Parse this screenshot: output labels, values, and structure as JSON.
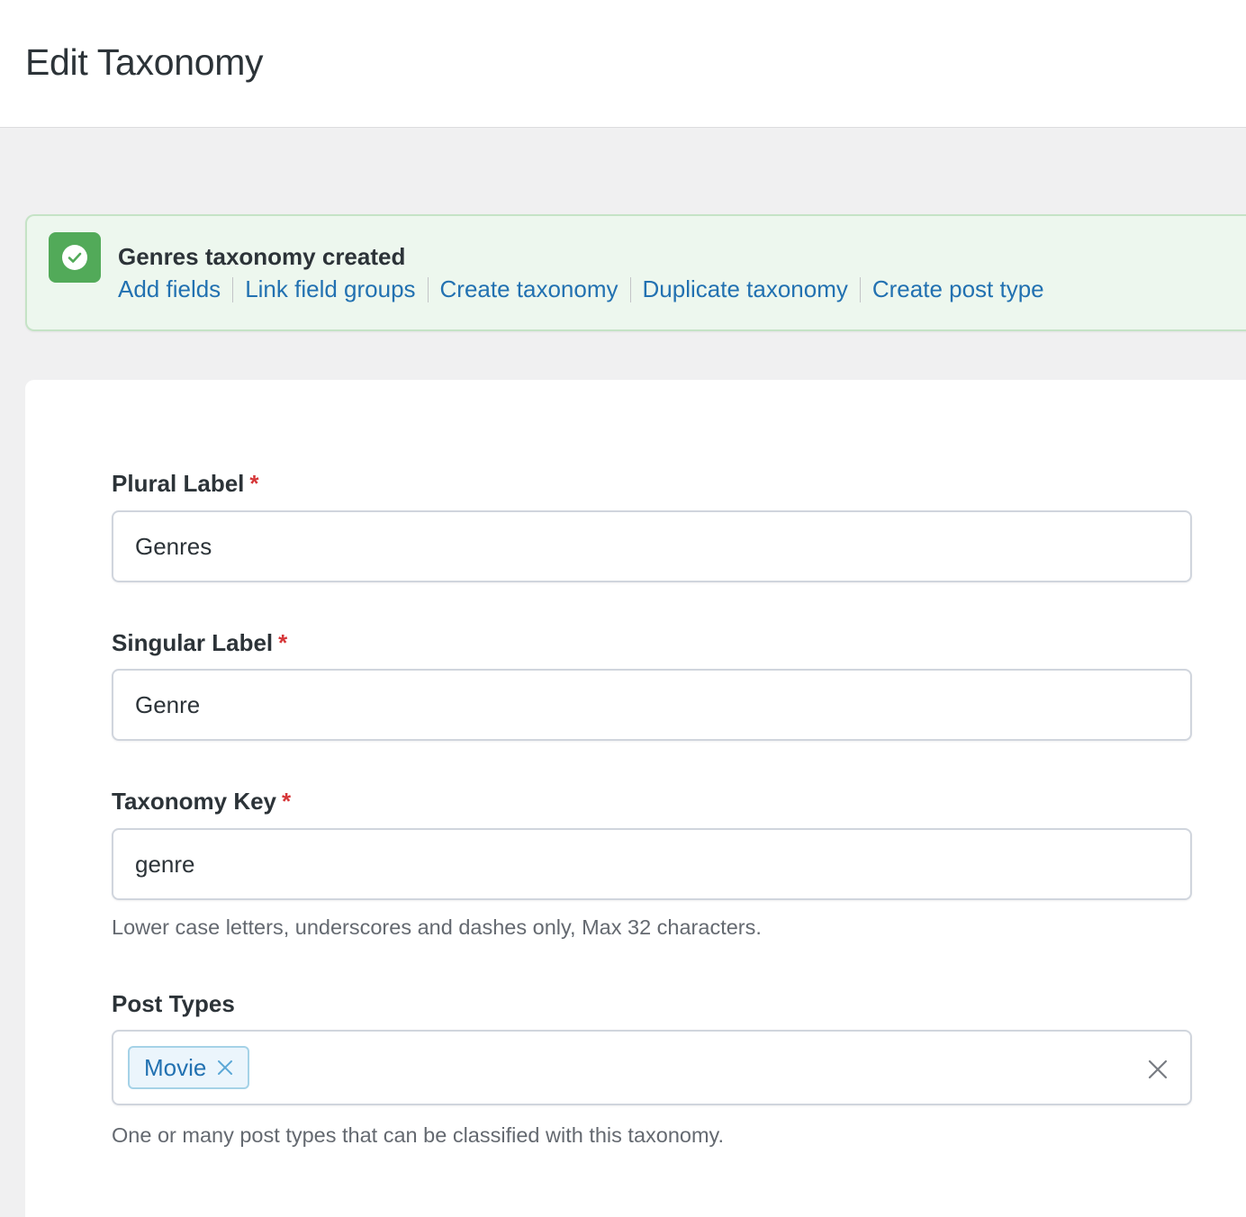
{
  "header": {
    "title": "Edit Taxonomy"
  },
  "notice": {
    "icon": "check-circle-icon",
    "title": "Genres taxonomy created",
    "links": [
      {
        "label": "Add fields"
      },
      {
        "label": "Link field groups"
      },
      {
        "label": "Create taxonomy"
      },
      {
        "label": "Duplicate taxonomy"
      },
      {
        "label": "Create post type"
      }
    ]
  },
  "form": {
    "plural_label": {
      "label": "Plural Label",
      "required_marker": "*",
      "value": "Genres"
    },
    "singular_label": {
      "label": "Singular Label",
      "required_marker": "*",
      "value": "Genre"
    },
    "taxonomy_key": {
      "label": "Taxonomy Key",
      "required_marker": "*",
      "value": "genre",
      "help": "Lower case letters, underscores and dashes only, Max 32 characters."
    },
    "post_types": {
      "label": "Post Types",
      "selected": [
        {
          "label": "Movie"
        }
      ],
      "help": "One or many post types that can be classified with this taxonomy."
    }
  },
  "colors": {
    "accent": "#2271b1",
    "success": "#52aa59",
    "notice_bg": "#edf7ee",
    "required": "#d63638"
  }
}
